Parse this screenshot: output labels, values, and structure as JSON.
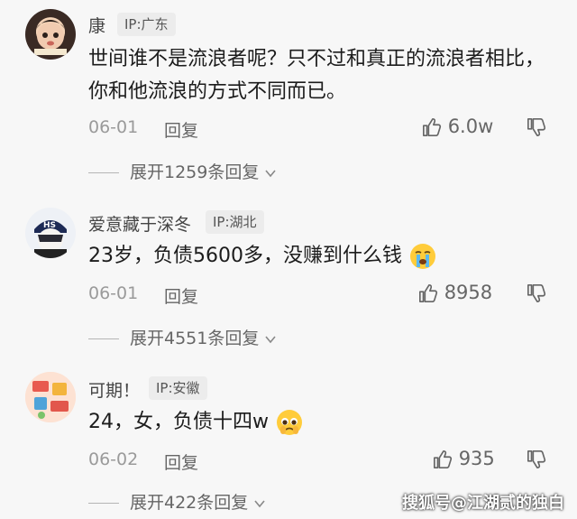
{
  "comments": [
    {
      "user": "康",
      "ip": "IP:广东",
      "text": "世间谁不是流浪者呢？只不过和真正的流浪者相比，你和他流浪的方式不同而已。",
      "date": "06-01",
      "reply_label": "回复",
      "likes": "6.0w",
      "expand": "展开1259条回复",
      "avatar_icon": "child-avatar"
    },
    {
      "user": "爱意藏于深冬",
      "ip": "IP:湖北",
      "text": "23岁，负债5600多，没赚到什么钱",
      "emoji": "crying-face",
      "date": "06-01",
      "reply_label": "回复",
      "likes": "8958",
      "expand": "展开4551条回复",
      "avatar_icon": "cartoon-cap-avatar"
    },
    {
      "user": "可期！",
      "ip": "IP:安徽",
      "text": "24，女，负债十四w",
      "emoji": "pleading-face",
      "date": "06-02",
      "reply_label": "回复",
      "likes": "935",
      "expand": "展开422条回复",
      "avatar_icon": "sticker-avatar"
    }
  ],
  "watermark": "搜狐号@江湖贰的独白",
  "colors": {
    "background": "#f7f7f7",
    "text": "#1c1c1c",
    "muted": "#9a9a9a"
  }
}
